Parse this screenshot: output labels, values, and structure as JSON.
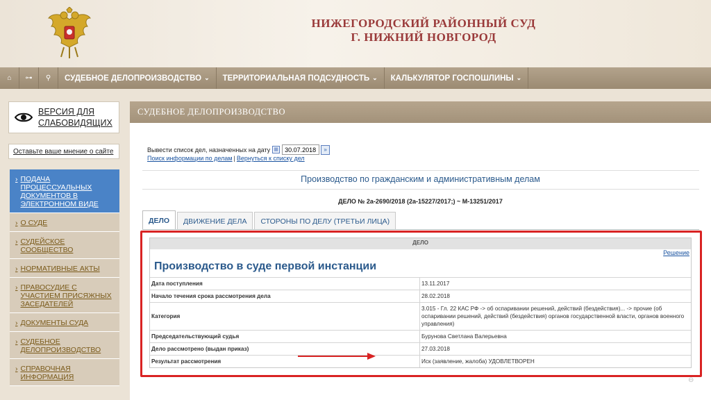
{
  "header": {
    "title_line1": "НИЖЕГОРОДСКИЙ РАЙОННЫЙ СУД",
    "title_line2": "Г. НИЖНИЙ НОВГОРОД",
    "emblem": "russian-coat-of-arms"
  },
  "topnav": {
    "icons": [
      "home-icon",
      "sitemap-icon",
      "search-icon"
    ],
    "icon_glyphs": [
      "⌂",
      "⊶",
      "⚲"
    ],
    "items": [
      {
        "label": "СУДЕБНОЕ ДЕЛОПРОИЗВОДСТВО"
      },
      {
        "label": "ТЕРРИТОРИАЛЬНАЯ ПОДСУДНОСТЬ"
      },
      {
        "label": "КАЛЬКУЛЯТОР ГОСПОШЛИНЫ"
      }
    ]
  },
  "sidebar": {
    "vision_line1": "ВЕРСИЯ ДЛЯ",
    "vision_line2": "СЛАБОВИДЯЩИХ",
    "feedback": "Оставьте ваше мнение о сайте",
    "items": [
      {
        "label": "ПОДАЧА ПРОЦЕССУАЛЬНЫХ ДОКУМЕНТОВ В ЭЛЕКТРОННОМ ВИДЕ",
        "active": true
      },
      {
        "label": "О СУДЕ"
      },
      {
        "label": "СУДЕЙСКОЕ СООБЩЕСТВО"
      },
      {
        "label": "НОРМАТИВНЫЕ АКТЫ"
      },
      {
        "label": "ПРАВОСУДИЕ С УЧАСТИЕМ ПРИСЯЖНЫХ ЗАСЕДАТЕЛЕЙ"
      },
      {
        "label": "ДОКУМЕНТЫ СУДА"
      },
      {
        "label": "СУДЕБНОЕ ДЕЛОПРОИЗВОДСТВО"
      },
      {
        "label": "СПРАВОЧНАЯ ИНФОРМАЦИЯ"
      }
    ]
  },
  "main": {
    "section_title": "СУДЕБНОЕ ДЕЛОПРОИЗВОДСТВО",
    "date_label": "Вывести список дел, назначенных на дату",
    "date_value": "30.07.2018",
    "link_search": "Поиск информации по делам",
    "link_back": "Вернуться к списку дел",
    "production_title": "Производство по гражданским и административным делам",
    "case_number": "ДЕЛО № 2а-2690/2018 (2а-15227/2017;) ~ М-13251/2017",
    "tabs": [
      {
        "label": "ДЕЛО",
        "active": true
      },
      {
        "label": "ДВИЖЕНИЕ ДЕЛА"
      },
      {
        "label": "СТОРОНЫ ПО ДЕЛУ (ТРЕТЬИ ЛИЦА)"
      }
    ],
    "table": {
      "head": "ДЕЛО",
      "decision_link": "Решение",
      "instance_title": "Производство в суде первой инстанции",
      "rows": [
        {
          "label": "Дата поступления",
          "value": "13.11.2017"
        },
        {
          "label": "Начало течения срока рассмотрения дела",
          "value": "28.02.2018"
        },
        {
          "label": "Категория",
          "value": "3.015 - Гл. 22 КАС РФ -> об оспаривании решений, действий (бездействия)... -> прочие (об оспаривании решений, действий (бездействия) органов государственной власти, органов военного управления)"
        },
        {
          "label": "Председательствующий судья",
          "value": "Бурунова Светлана Валерьевна"
        },
        {
          "label": "Дело рассмотрено (выдан приказ)",
          "value": "27.03.2018"
        },
        {
          "label": "Результат рассмотрения",
          "value": "Иск (заявление, жалоба) УДОВЛЕТВОРЕН"
        }
      ]
    }
  },
  "colors": {
    "title_red": "#9a3a3a",
    "nav_bg": "#a3927a",
    "sidebar_active": "#4a83c7",
    "highlight_red": "#d92323",
    "link_blue": "#1a53a0"
  }
}
